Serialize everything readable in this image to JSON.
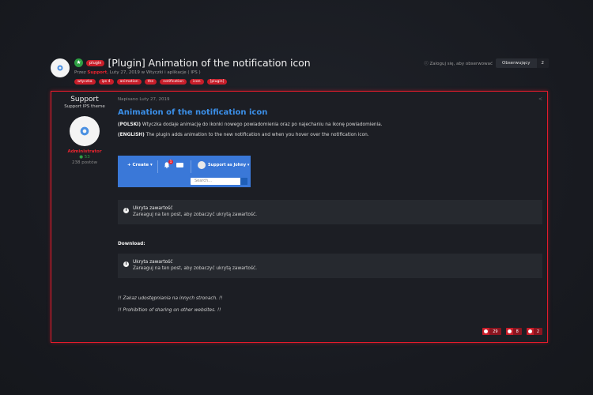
{
  "topic": {
    "title": "[Plugin] Animation of the notification icon",
    "prefix_tag": "plugin",
    "meta_prefix": "Przez ",
    "meta_author": "Support",
    "meta_suffix": ", Luty 27, 2019 w Wtyczki i aplikacje ( IPS )",
    "tags": [
      "wtyczka",
      "ips 4",
      "animation",
      "the",
      "notification",
      "icon",
      "[plugin]"
    ],
    "login_follow": "Zaloguj się, aby obserwować",
    "follow_label": "Obserwujący",
    "follow_count": "2"
  },
  "author": {
    "name": "Support",
    "theme": "Support IPS theme",
    "role": "Administrator",
    "reputation": "53",
    "posts": "238 postów"
  },
  "post": {
    "posted": "Napisano Luty 27, 2019",
    "title": "Animation of the notification icon",
    "pl_label": "(POLSKI)",
    "pl_text": " Wtyczka dodaje animację do ikonki nowego powiadomienia oraz po najechaniu na ikonę powiadomienia.",
    "en_label": "(ENGLISH)",
    "en_text": " The plugin adds animation to the new notification and when you hover over the notification icon.",
    "preview": {
      "create": "+ Create ▾",
      "badge": "1",
      "user": "Support as Johny ▾",
      "search_placeholder": "Search..."
    },
    "hidden_title": "Ukryta zawartość",
    "hidden_desc": "Zareaguj na ten post, aby zobaczyć ukrytą zawartość.",
    "download": "Download:",
    "no_share_pl": "!! Zakaz udostępniania na innych stronach. !!",
    "no_share_en": "!! Prohibition of sharing on other websites. !!",
    "reactions": [
      "29",
      "8",
      "2"
    ]
  }
}
